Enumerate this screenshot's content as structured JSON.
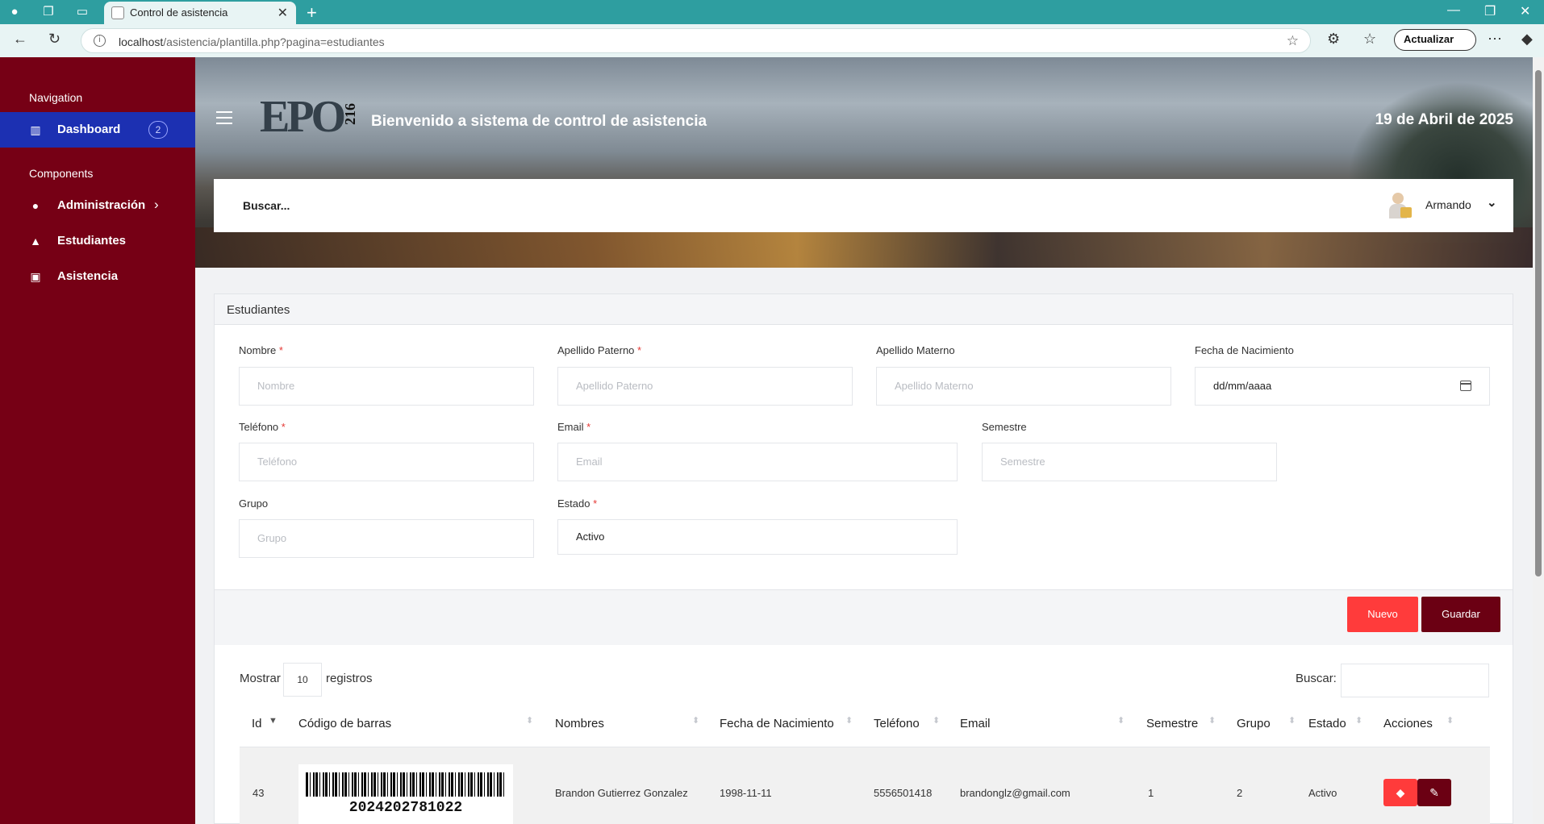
{
  "browser": {
    "tab_title": "Control de asistencia",
    "url_host": "localhost",
    "url_path": "/asistencia/plantilla.php?pagina=estudiantes",
    "update_label": "Actualizar"
  },
  "sidebar": {
    "nav_heading": "Navigation",
    "components_heading": "Components",
    "items": [
      {
        "label": "Dashboard",
        "badge": "2",
        "icon": "dashboard-icon"
      },
      {
        "label": "Administración",
        "icon": "user-circle-icon"
      },
      {
        "label": "Estudiantes",
        "icon": "graduation-cap-icon"
      },
      {
        "label": "Asistencia",
        "icon": "calendar-icon"
      }
    ]
  },
  "header": {
    "logo_text": "EPO",
    "logo_number": "216",
    "welcome": "Bienvenido a sistema de control de asistencia",
    "date": "19 de Abril de 2025",
    "search_label": "Buscar...",
    "user_name": "Armando"
  },
  "form": {
    "title": "Estudiantes",
    "fields": {
      "nombre": {
        "label": "Nombre",
        "placeholder": "Nombre"
      },
      "ap_paterno": {
        "label": "Apellido Paterno",
        "placeholder": "Apellido Paterno"
      },
      "ap_materno": {
        "label": "Apellido Materno",
        "placeholder": "Apellido Materno"
      },
      "fecha": {
        "label": "Fecha de Nacimiento",
        "value": "dd/mm/aaaa"
      },
      "telefono": {
        "label": "Teléfono",
        "placeholder": "Teléfono"
      },
      "email": {
        "label": "Email",
        "placeholder": "Email"
      },
      "semestre": {
        "label": "Semestre",
        "placeholder": "Semestre"
      },
      "grupo": {
        "label": "Grupo",
        "placeholder": "Grupo"
      },
      "estado": {
        "label": "Estado",
        "value": "Activo"
      }
    },
    "required_mark": "*",
    "buttons": {
      "nuevo": "Nuevo",
      "guardar": "Guardar"
    }
  },
  "table": {
    "show_label": "Mostrar",
    "page_size": "10",
    "records_label": "registros",
    "search_label": "Buscar:",
    "columns": [
      "Id",
      "Código de barras",
      "Nombres",
      "Fecha de Nacimiento",
      "Teléfono",
      "Email",
      "Semestre",
      "Grupo",
      "Estado",
      "Acciones"
    ],
    "rows": [
      {
        "id": "43",
        "barcode": "2024202781022",
        "nombres": "Brandon Gutierrez Gonzalez",
        "fecha": "1998-11-11",
        "telefono": "5556501418",
        "email": "brandonglz@gmail.com",
        "semestre": "1",
        "grupo": "2",
        "estado": "Activo"
      }
    ]
  },
  "colors": {
    "sidebar": "#760015",
    "active": "#1c30b2",
    "nuevo": "#ff3b3b",
    "guardar": "#6b0013"
  }
}
